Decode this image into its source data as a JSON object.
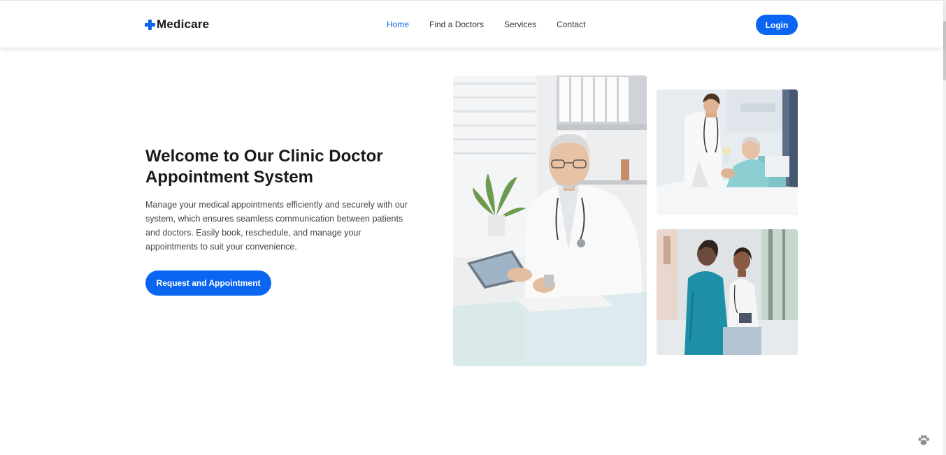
{
  "header": {
    "brand": "Medicare",
    "nav": [
      {
        "label": "Home",
        "active": true
      },
      {
        "label": "Find a Doctors",
        "active": false
      },
      {
        "label": "Services",
        "active": false
      },
      {
        "label": "Contact",
        "active": false
      }
    ],
    "login_label": "Login"
  },
  "hero": {
    "title_line1": "Welcome to Our Clinic Doctor",
    "title_line2": "Appointment System",
    "description": "Manage your medical appointments efficiently and securely with our system, which ensures seamless communication between patients and doctors. Easily book, reschedule, and manage your appointments to suit your convenience.",
    "cta_label": "Request and Appointment"
  },
  "images": {
    "main": "doctor-with-tablet-photo",
    "top": "nurse-with-elderly-patient-photo",
    "bottom": "doctor-consulting-patient-photo"
  },
  "icons": {
    "logo": "medical-cross-icon",
    "corner": "paw-icon"
  },
  "colors": {
    "accent": "#0a66f0",
    "text": "#1a1a1a"
  }
}
